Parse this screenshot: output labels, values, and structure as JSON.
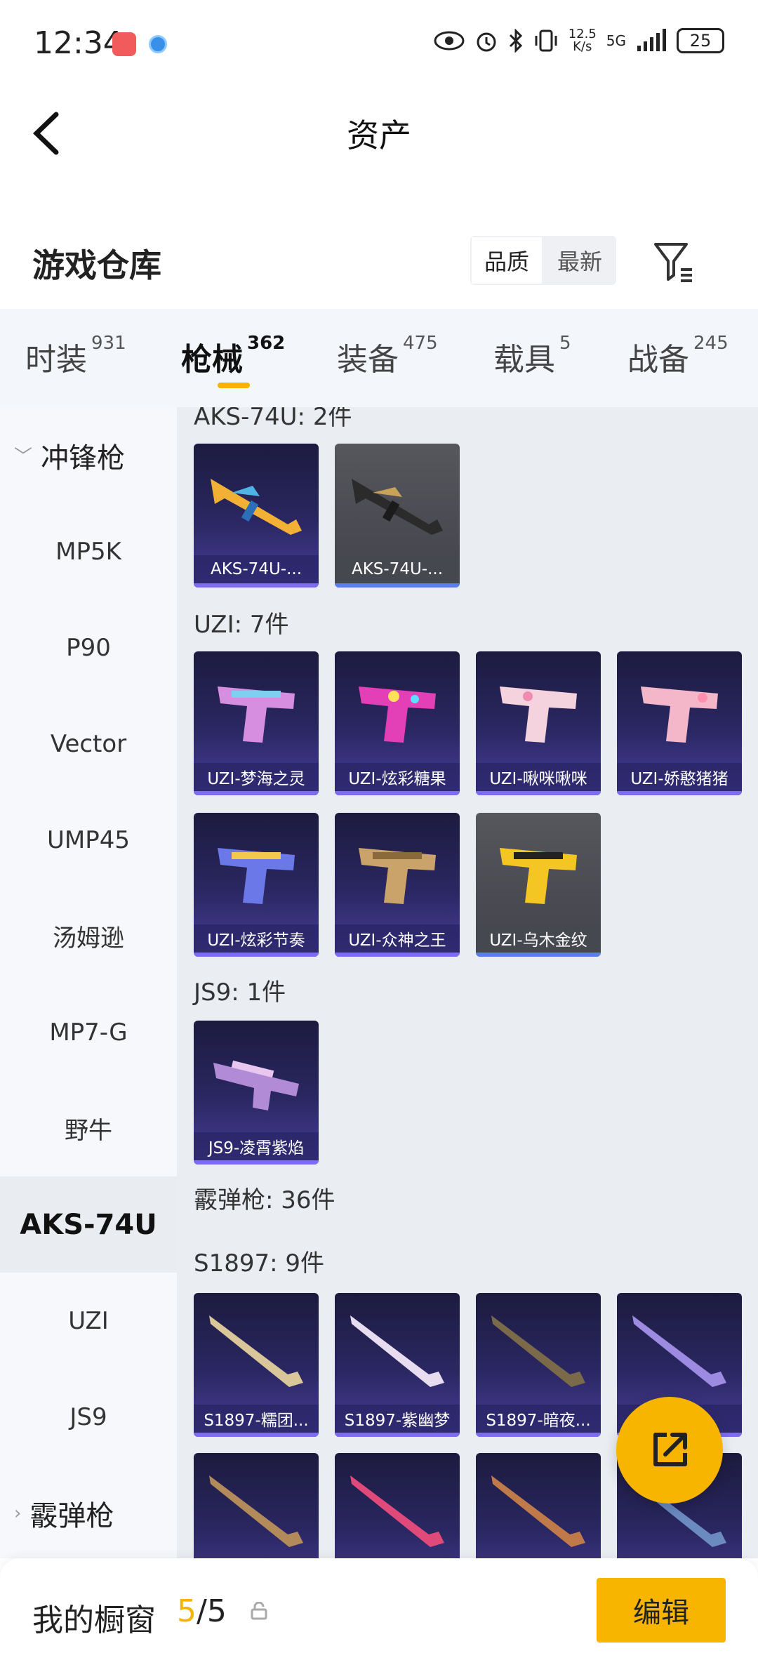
{
  "status_bar": {
    "time": "12:34",
    "net_speed_value": "12.5",
    "net_speed_unit": "K/s",
    "network": "5G",
    "battery": "25"
  },
  "header": {
    "title": "资产"
  },
  "warehouse": {
    "title": "游戏仓库",
    "sort_options": [
      "品质",
      "最新"
    ],
    "selected_sort": "品质"
  },
  "tabs": [
    {
      "label": "时装",
      "count": "931"
    },
    {
      "label": "枪械",
      "count": "362"
    },
    {
      "label": "装备",
      "count": "475"
    },
    {
      "label": "载具",
      "count": "5"
    },
    {
      "label": "战备",
      "count": "245"
    }
  ],
  "active_tab": "枪械",
  "sidebar": [
    {
      "label": "冲锋枪",
      "type": "group"
    },
    {
      "label": "MP5K"
    },
    {
      "label": "P90"
    },
    {
      "label": "Vector"
    },
    {
      "label": "UMP45"
    },
    {
      "label": "汤姆逊"
    },
    {
      "label": "MP7-G"
    },
    {
      "label": "野牛"
    },
    {
      "label": "AKS-74U",
      "selected": true
    },
    {
      "label": "UZI"
    },
    {
      "label": "JS9"
    },
    {
      "label": "霰弹枪",
      "type": "group"
    }
  ],
  "sections": {
    "aks": {
      "label": "AKS-74U: 2件",
      "items": [
        "AKS-74U-...",
        "AKS-74U-..."
      ]
    },
    "uzi": {
      "label": "UZI: 7件",
      "items": [
        "UZI-梦海之灵",
        "UZI-炫彩糖果",
        "UZI-啾咪啾咪",
        "UZI-娇憨猪猪",
        "UZI-炫彩节奏",
        "UZI-众神之王",
        "UZI-乌木金纹"
      ]
    },
    "js9": {
      "label": "JS9: 1件",
      "items": [
        "JS9-凌霄紫焰"
      ]
    },
    "shotgun": {
      "label": "霰弹枪: 36件"
    },
    "s1897": {
      "label": "S1897: 9件",
      "items": [
        "S1897-糯团...",
        "S1897-紫幽梦",
        "S1897-暗夜...",
        "S1897-..."
      ]
    }
  },
  "bottom_bar": {
    "label": "我的橱窗",
    "count_current": "5",
    "count_sep": "/",
    "count_total": "5",
    "edit_label": "编辑"
  },
  "colors": {
    "accent": "#f7b500",
    "card_purple": "#2b2763",
    "card_gray": "#4a4b52"
  },
  "icons": [
    "back-arrow-icon",
    "filter-icon",
    "eye-icon",
    "alarm-icon",
    "bluetooth-icon",
    "vibrate-icon",
    "signal-icon",
    "battery-icon",
    "share-icon",
    "lock-icon",
    "chevron-down-icon",
    "chevron-right-icon"
  ]
}
